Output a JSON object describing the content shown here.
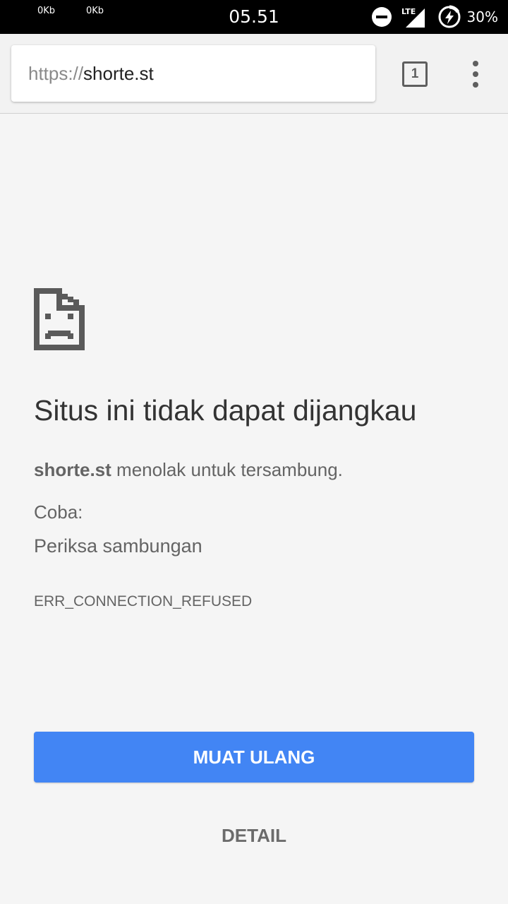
{
  "status_bar": {
    "upload_speed": "0Kb",
    "download_speed": "0Kb",
    "time": "05.51",
    "network_type": "LTE",
    "battery_percent": "30%"
  },
  "toolbar": {
    "url_scheme": "https://",
    "url_host": "shorte.st",
    "tab_count": "1"
  },
  "error_page": {
    "title": "Situs ini tidak dapat dijangkau",
    "host": "shorte.st",
    "description_suffix": " menolak untuk tersambung.",
    "try_label": "Coba:",
    "suggestion": "Periksa sambungan",
    "error_code": "ERR_CONNECTION_REFUSED",
    "reload_label": "MUAT ULANG",
    "details_label": "DETAIL"
  },
  "icons": {
    "do_not_disturb": "do-not-disturb-icon",
    "signal": "cellular-signal-icon",
    "battery": "battery-charging-icon",
    "menu": "more-vert-icon",
    "error": "sad-document-icon"
  },
  "colors": {
    "accent": "#4285f4",
    "background": "#f5f5f5",
    "status_bar": "#000000"
  }
}
